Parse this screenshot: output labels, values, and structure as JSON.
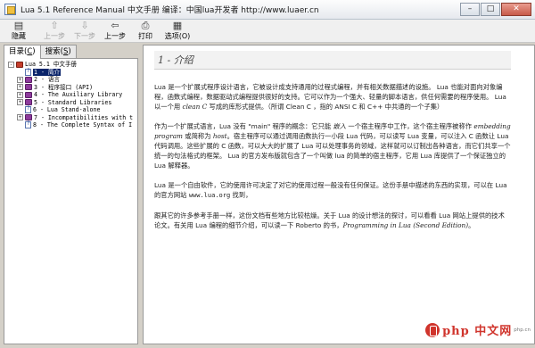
{
  "window": {
    "title": "Lua 5.1 Reference Manual 中文手册 编译：中国lua开发者 http://www.luaer.cn"
  },
  "toolbar": {
    "buttons": [
      {
        "label": "隐藏",
        "icon": "hide-pane-icon",
        "enabled": true
      },
      {
        "label": "上一步",
        "icon": "arrow-up-icon",
        "enabled": false
      },
      {
        "label": "下一步",
        "icon": "arrow-down-icon",
        "enabled": false
      },
      {
        "label": "上一步",
        "icon": "back-arrow-icon",
        "enabled": true
      },
      {
        "label": "打印",
        "icon": "printer-icon",
        "enabled": true
      },
      {
        "label": "选项(O)",
        "icon": "options-icon",
        "enabled": true
      }
    ]
  },
  "nav": {
    "tabs": [
      {
        "label": "目录",
        "accel": "C"
      },
      {
        "label": "搜索",
        "accel": "S"
      }
    ],
    "tree": [
      {
        "label": "Lua 5.1 中文手册",
        "level": 0,
        "type": "book",
        "expander": "-"
      },
      {
        "label": "1 - 简介",
        "level": 1,
        "type": "page",
        "selected": true
      },
      {
        "label": "2 - 语言",
        "level": 1,
        "type": "book",
        "expander": "+"
      },
      {
        "label": "3 - 程序接口 (API)",
        "level": 1,
        "type": "book",
        "expander": "+"
      },
      {
        "label": "4 - The Auxiliary Library",
        "level": 1,
        "type": "book",
        "expander": "+"
      },
      {
        "label": "5 - Standard Libraries",
        "level": 1,
        "type": "book",
        "expander": "+"
      },
      {
        "label": "6 - Lua Stand-alone",
        "level": 1,
        "type": "page"
      },
      {
        "label": "7 - Incompatibilities with t",
        "level": 1,
        "type": "book",
        "expander": "+"
      },
      {
        "label": "8 - The Complete Syntax of I",
        "level": 1,
        "type": "page"
      }
    ]
  },
  "content": {
    "heading": "1 - 介绍",
    "p1": "Lua 是一个扩展式程序设计语言，它被设计成支持通用的过程式编程，并有相关数据描述的设施。 Lua 也能对面向对象编程，函数式编程，数据驱动式编程提供很好的支持。它可以作为一个强大、轻量的脚本语言，供任何需要的程序使用。 Lua 以一个用 ",
    "p1_em": "clean C",
    "p1_end": " 写成的库形式提供。（所谓 Clean C ，指的 ANSI C 和 C++ 中共通的一个子集）",
    "p2a": "作为一个扩展式语言，Lua 没有 \"main\" 程序的概念：它只能 ",
    "p2_em1": "嵌入",
    "p2b": " 一个宿主程序中工作，这个宿主程序被称作 ",
    "p2_em2": "embedding program",
    "p2c": " 或简称为 ",
    "p2_em3": "host",
    "p2d": "。宿主程序可以通过调用函数执行一小段 Lua 代码，可以读写 Lua 变量，可以注入 C 函数让 Lua 代码调用。这些扩展的 C 函数，可以大大的扩展了 Lua 可以处理事务的领域，这样就可以订制出各种语言，而它们共享一个统一的句法格式的框架。 Lua 的官方发布版就包含了一个叫做 lua 的简单的宿主程序，它用 Lua 库提供了一个保证独立的 Lua 解释器。",
    "p3a": "Lua 是一个自由软件，它的使用许可决定了对它的使用过程一般没有任何保证。这份手册中描述的东西的实现，可以在 Lua 的官方网站 ",
    "p3_code": "www.lua.org",
    "p3b": " 找到，",
    "p4a": "跟其它的许多参考手册一样，这份文档有些地方比较枯燥。关于 Lua 的设计想法的探讨，可以看看 Lua 网站上提供的技术论文。有关用 Lua 编程的细节介绍，可以读一下 Roberto 的书，",
    "p4_em": "Programming in Lua (Second Edition)",
    "p4b": "。"
  },
  "watermark": {
    "logo": "php 中文网",
    "sub": "php.cn"
  }
}
